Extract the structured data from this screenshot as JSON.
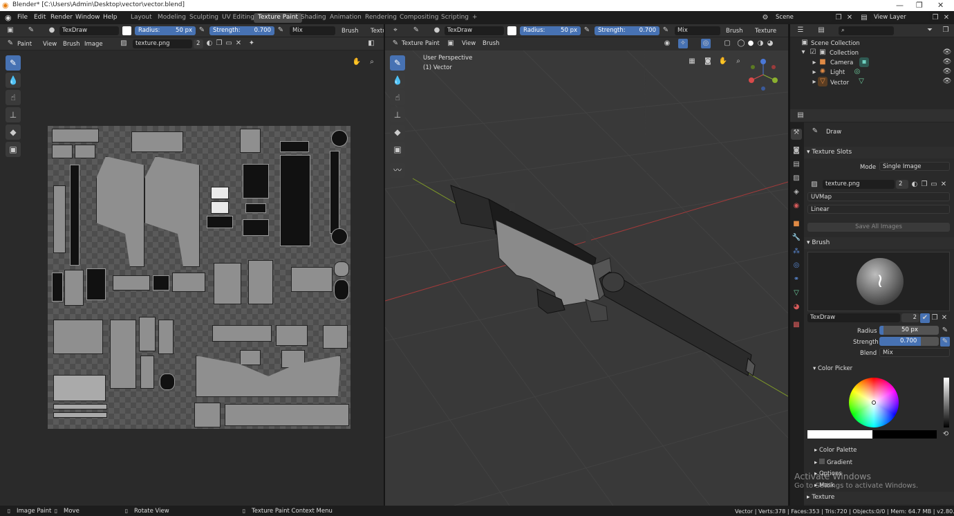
{
  "title": "Blender* [C:\\Users\\Admin\\Desktop\\vector\\vector.blend]",
  "menu": [
    "File",
    "Edit",
    "Render",
    "Window",
    "Help"
  ],
  "workspaces": [
    "Layout",
    "Modeling",
    "Sculpting",
    "UV Editing",
    "Texture Paint",
    "Shading",
    "Animation",
    "Rendering",
    "Compositing",
    "Scripting",
    "+"
  ],
  "scene": "Scene",
  "view_layer": "View Layer",
  "tool_header": {
    "brush": "TexDraw",
    "radius_label": "Radius:",
    "radius": "50 px",
    "strength_label": "Strength:",
    "strength": "0.700",
    "blend": "Mix",
    "brush_menu": "Brush",
    "texture_menu": "Texture",
    "texture_menu_short": "Textu"
  },
  "image_editor": {
    "mode": "Paint",
    "menus": [
      "View",
      "Brush",
      "Image"
    ],
    "image": "texture.png",
    "users": "2"
  },
  "viewport": {
    "mode": "Texture Paint",
    "menus": [
      "View",
      "Brush"
    ],
    "perspective": "User Perspective",
    "object": "(1) Vector"
  },
  "outliner": {
    "root": "Scene Collection",
    "collection": "Collection",
    "items": [
      "Camera",
      "Light",
      "Vector"
    ]
  },
  "properties": {
    "tool_name": "Draw",
    "texture_slots": "Texture Slots",
    "mode_label": "Mode",
    "mode": "Single Image",
    "image": "texture.png",
    "users": "2",
    "uvmap": "UVMap",
    "interpolation": "Linear",
    "save_all": "Save All Images",
    "brush_section": "Brush",
    "brush_name": "TexDraw",
    "brush_users": "2",
    "radius_label": "Radius",
    "radius": "50 px",
    "strength_label": "Strength",
    "strength": "0.700",
    "blend_label": "Blend",
    "blend": "Mix",
    "color_picker": "Color Picker",
    "color_palette": "Color Palette",
    "gradient": "Gradient",
    "options": "Options",
    "mask": "Mask",
    "texture": "Texture"
  },
  "watermark": {
    "line1": "Activate Windows",
    "line2": "Go to Settings to activate Windows."
  },
  "status": {
    "left1": "Image Paint",
    "left2": "Move",
    "left3": "Rotate View",
    "left4": "Texture Paint Context Menu",
    "right": "Vector | Verts:378 | Faces:353 | Tris:720 | Objects:0/0 | Mem: 64.7 MB | v2.80.75"
  },
  "colors": {
    "accent": "#4772b3",
    "active_ws": "#4a4a4a",
    "bg": "#232323"
  }
}
